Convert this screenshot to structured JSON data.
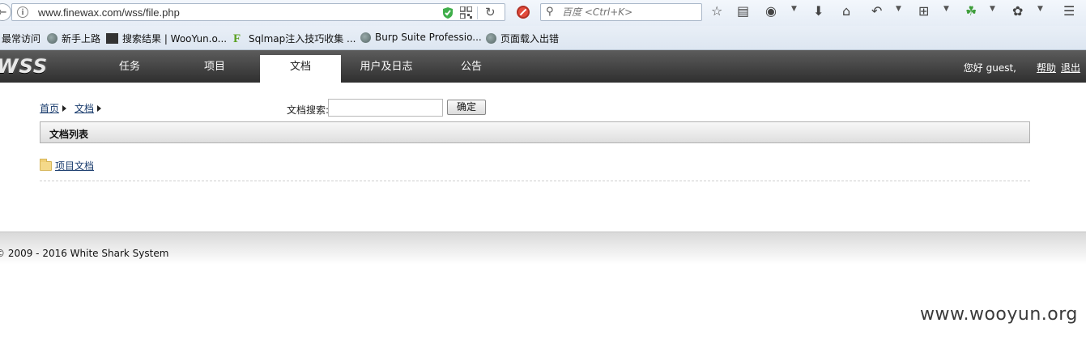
{
  "browser": {
    "url": "www.finewax.com/wss/file.php",
    "search_placeholder": "百度 <Ctrl+K>"
  },
  "bookmarks": [
    {
      "label": "最常访问"
    },
    {
      "label": "新手上路"
    },
    {
      "label": "搜索结果 | WooYun.o..."
    },
    {
      "label": "Sqlmap注入技巧收集 ..."
    },
    {
      "label": "Burp Suite Professio..."
    },
    {
      "label": "页面载入出错"
    }
  ],
  "site": {
    "logo": "WSS",
    "tabs": [
      {
        "label": "任务"
      },
      {
        "label": "项目"
      },
      {
        "label": "文档",
        "active": true
      },
      {
        "label": "用户及日志"
      },
      {
        "label": "公告"
      }
    ],
    "greeting": "您好 guest,",
    "help": "帮助",
    "logout": "退出"
  },
  "content": {
    "breadcrumb": [
      "首页",
      "文档"
    ],
    "search_label": "文档搜索:",
    "search_value": "",
    "ok_label": "确定",
    "panel_title": "文档列表",
    "folders": [
      {
        "label": "项目文档"
      }
    ]
  },
  "footer": {
    "copyright": "© 2009 - 2016 White Shark System"
  },
  "watermark": "www.wooyun.org",
  "colors": {
    "header_bg": "#3f3f3f",
    "link": "#1a3c6e",
    "panel_bg": "#e6e6e6"
  }
}
